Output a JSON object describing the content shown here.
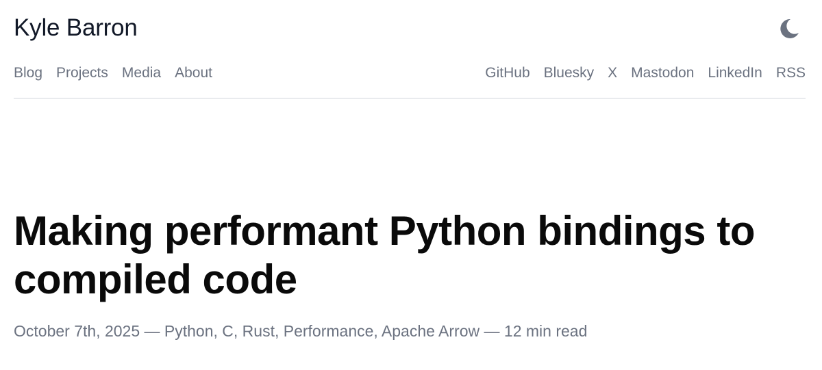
{
  "site": {
    "title": "Kyle Barron"
  },
  "theme_toggle": {
    "icon": "moon-icon",
    "color": "#6b7280"
  },
  "nav": {
    "left": [
      {
        "label": "Blog"
      },
      {
        "label": "Projects"
      },
      {
        "label": "Media"
      },
      {
        "label": "About"
      }
    ],
    "right": [
      {
        "label": "GitHub"
      },
      {
        "label": "Bluesky"
      },
      {
        "label": "X"
      },
      {
        "label": "Mastodon"
      },
      {
        "label": "LinkedIn"
      },
      {
        "label": "RSS"
      }
    ]
  },
  "post": {
    "title": "Making performant Python bindings to compiled code",
    "meta": "October 7th, 2025 — Python, C, Rust, Performance, Apache Arrow — 12 min read"
  },
  "colors": {
    "text": "#111827",
    "muted": "#6b7280",
    "divider": "#d1d5db",
    "background": "#ffffff"
  }
}
